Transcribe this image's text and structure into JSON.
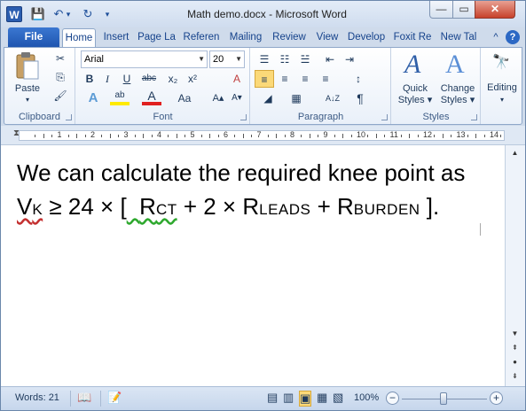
{
  "titlebar": {
    "title": "Math demo.docx - Microsoft Word",
    "app_icon": "W",
    "qat": {
      "save": "💾",
      "undo": "↶",
      "undo_dd": "▾",
      "redo": "↻",
      "customize": "▾"
    },
    "minimize": "—",
    "maximize": "▭",
    "close": "✕"
  },
  "tabs": {
    "file": "File",
    "items": [
      "Home",
      "Insert",
      "Page La",
      "Referen",
      "Mailing",
      "Review",
      "View",
      "Develop",
      "Foxit Re",
      "New Tal"
    ],
    "collapse_icon": "^",
    "help_icon": "?"
  },
  "ribbon": {
    "clipboard": {
      "label": "Clipboard",
      "paste": "Paste",
      "paste_dd": "▾",
      "cut": "✂",
      "copy": "⎘",
      "format_painter": "🖌"
    },
    "font": {
      "label": "Font",
      "font_name": "Arial",
      "font_size": "20",
      "grow": "A▴",
      "shrink": "A▾",
      "bold": "B",
      "italic": "I",
      "underline": "U",
      "strike": "abc",
      "subscript": "x₂",
      "superscript": "x²",
      "clear": "A",
      "text_effects": "A",
      "highlight": "ab",
      "font_color": "A",
      "change_case": "Aa"
    },
    "paragraph": {
      "label": "Paragraph",
      "bullets": "☰",
      "numbering": "☷",
      "multilevel": "☱",
      "decrease_indent": "⇤",
      "increase_indent": "⇥",
      "align_left": "≡",
      "center": "≡",
      "align_right": "≡",
      "justify": "≡",
      "line_spacing": "↕",
      "shading": "◢",
      "borders": "▦",
      "sort": "A↓Z",
      "show_marks": "¶"
    },
    "styles": {
      "label": "Styles",
      "quick_styles": "Quick\nStyles",
      "quick_styles_l1": "Quick",
      "quick_styles_l2": "Styles ▾",
      "change_styles_l1": "Change",
      "change_styles_l2": "Styles ▾",
      "icon": "A"
    },
    "editing": {
      "label": "Editing",
      "dd": "▾",
      "icon": "🔭"
    }
  },
  "ruler": {
    "numbers": [
      "1",
      "2",
      "3",
      "4",
      "5",
      "6",
      "7",
      "8",
      "9",
      "10",
      "11",
      "12",
      "13",
      "14"
    ]
  },
  "document": {
    "line1": "We can calculate the required knee point as",
    "vk_main": "V",
    "vk_sub": "K",
    "line2_a": " ≥ 24 × ",
    "bracket_open": "[",
    "rct_main": "R",
    "rct_sub": "CT",
    "plus2": " + 2 × R",
    "leads_sub": "LEADS",
    "plus_r": " + R",
    "burden_sub": "BURDEN",
    "bracket_close": " ].",
    "ibeam": "I"
  },
  "scrollbar": {
    "up": "▲",
    "down": "▼",
    "prev_page": "⇞",
    "select_browse": "●",
    "next_page": "⇟"
  },
  "status": {
    "words": "Words: 21",
    "proofing_icon": "📖",
    "macro_icon": "📝",
    "zoom": "100%",
    "zoom_out": "−",
    "zoom_in": "+",
    "view_icons": [
      "▤",
      "▥",
      "▣",
      "▦",
      "▧"
    ]
  }
}
